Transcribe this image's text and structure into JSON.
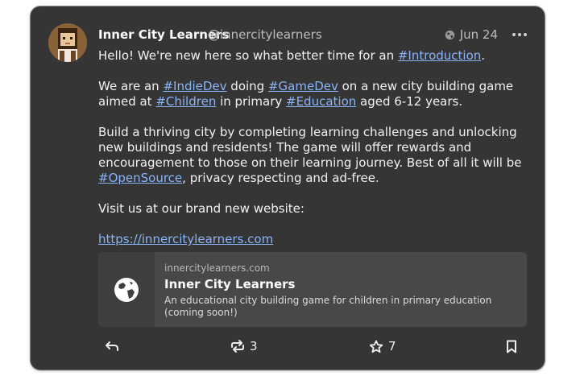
{
  "post": {
    "author_name": "Inner City Learners",
    "author_handle": "@innercitylearners",
    "date": "Jun 24",
    "content": {
      "p1_text": "Hello! We're new here so what better time for an ",
      "p1_tag": "#Introduction",
      "p1_end": ".",
      "p2_a": "We are an ",
      "p2_tag1": "#IndieDev",
      "p2_b": " doing ",
      "p2_tag2": "#GameDev",
      "p2_c": " on a new city building game aimed at ",
      "p2_tag3": "#Children",
      "p2_d": " in primary ",
      "p2_tag4": "#Education",
      "p2_e": " aged 6-12 years.",
      "p3_a": "Build a thriving city by completing learning challenges and unlocking new buildings and residents! The game will offer rewards and encouragement to those on their learning journey. Best of all it will be ",
      "p3_tag": "#OpenSource",
      "p3_b": ", privacy respecting and ad-free.",
      "p4": "Visit us at our brand new website:",
      "link": "https://innercitylearners.com"
    },
    "preview": {
      "domain": "innercitylearners.com",
      "title": "Inner City Learners",
      "description": "An educational city building game for children in primary education (coming soon!)"
    },
    "actions": {
      "boost_count": "3",
      "favourite_count": "7"
    }
  },
  "colors": {
    "card_bg": "#353535",
    "link": "#8ab4f8",
    "preview_bg": "#484848"
  },
  "icons": [
    "globe-icon",
    "more-icon",
    "reply-icon",
    "boost-icon",
    "star-icon",
    "bookmark-icon"
  ]
}
